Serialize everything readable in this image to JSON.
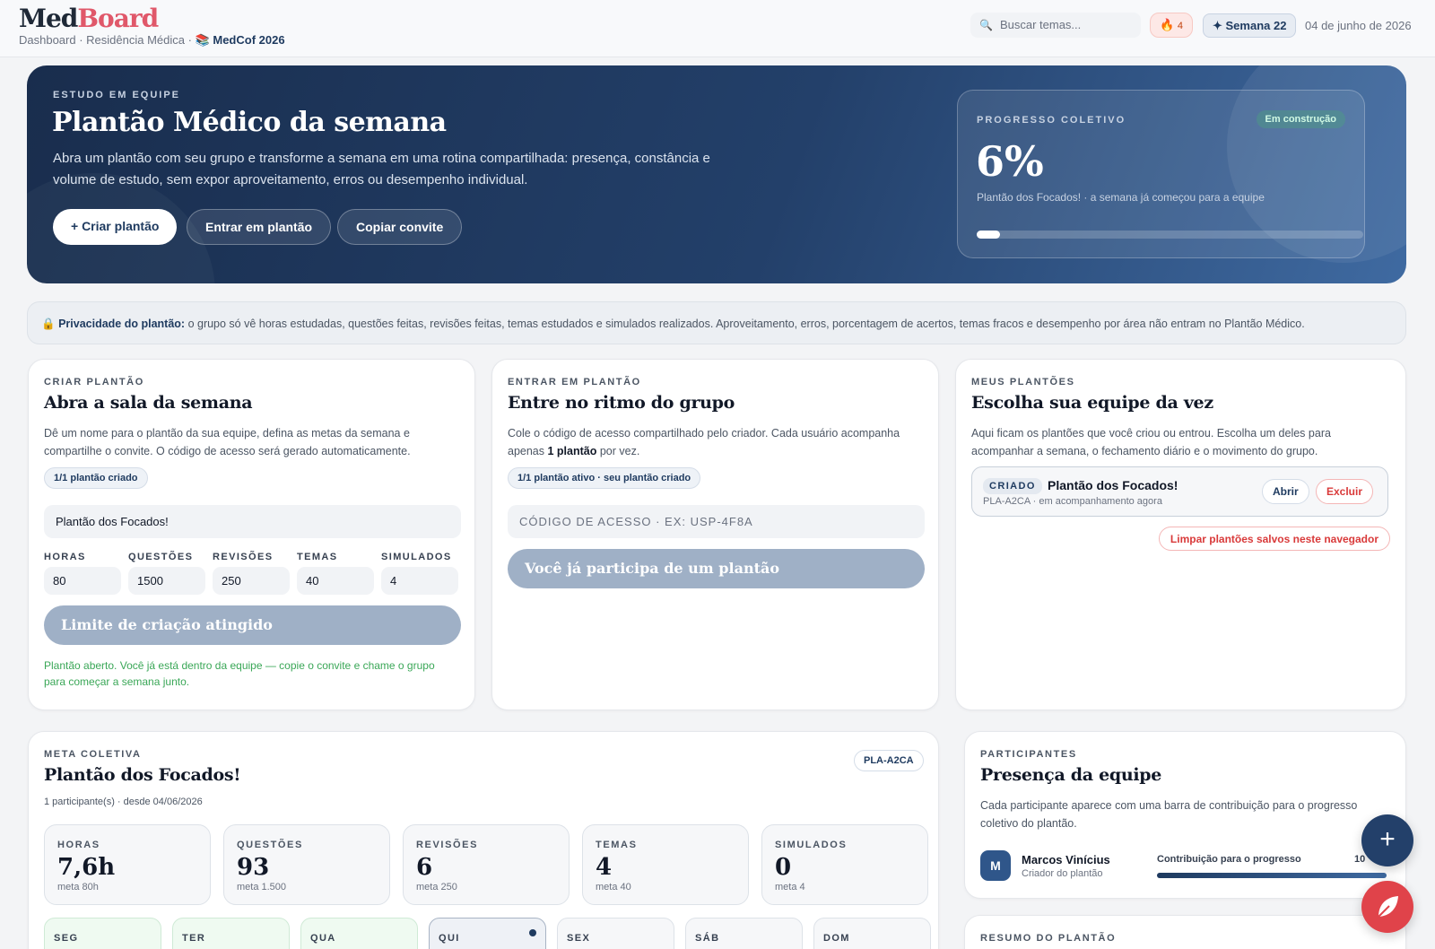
{
  "header": {
    "logo_part1": "Med",
    "logo_part2": "Board",
    "breadcrumb": "Dashboard · Residência Médica ·",
    "breadcrumb_book": "📚",
    "breadcrumb_exam": "MedCof 2026",
    "search_placeholder": "Buscar temas...",
    "streak": "4",
    "week": "✦ Semana 22",
    "date": "04 de junho de 2026"
  },
  "hero": {
    "eyebrow": "ESTUDO EM EQUIPE",
    "title": "Plantão Médico da semana",
    "description": "Abra um plantão com seu grupo e transforme a semana em uma rotina compartilhada: presença, constância e volume de estudo, sem expor aproveitamento, erros ou desempenho individual.",
    "btn_create": "+ Criar plantão",
    "btn_join": "Entrar em plantão",
    "btn_copy": "Copiar convite",
    "progress": {
      "label": "PROGRESSO COLETIVO",
      "badge": "Em construção",
      "percent_text": "6%",
      "percent_value": 6,
      "subtitle": "Plantão dos Focados! · a semana já começou para a equipe"
    }
  },
  "privacy": {
    "lead": "Privacidade do plantão:",
    "text": "o grupo só vê horas estudadas, questões feitas, revisões feitas, temas estudados e simulados realizados. Aproveitamento, erros, porcentagem de acertos, temas fracos e desempenho por área não entram no Plantão Médico."
  },
  "create": {
    "eyebrow": "CRIAR PLANTÃO",
    "title": "Abra a sala da semana",
    "text": "Dê um nome para o plantão da sua equipe, defina as metas da semana e compartilhe o convite. O código de acesso será gerado automaticamente.",
    "pill": "1/1 plantão criado",
    "name_value": "Plantão dos Focados!",
    "goals": [
      {
        "label": "HORAS",
        "value": "80"
      },
      {
        "label": "QUESTÕES",
        "value": "1500"
      },
      {
        "label": "REVISÕES",
        "value": "250"
      },
      {
        "label": "TEMAS",
        "value": "40"
      },
      {
        "label": "SIMULADOS",
        "value": "4"
      }
    ],
    "button": "Limite de criação atingido",
    "success": "Plantão aberto. Você já está dentro da equipe — copie o convite e chame o grupo para começar a semana junto."
  },
  "join": {
    "eyebrow": "ENTRAR EM PLANTÃO",
    "title": "Entre no ritmo do grupo",
    "text_before": "Cole o código de acesso compartilhado pelo criador. Cada usuário acompanha apenas",
    "text_bold": "1 plantão",
    "text_after": "por vez.",
    "pill": "1/1 plantão ativo · seu plantão criado",
    "code_placeholder": "CÓDIGO DE ACESSO · EX: USP-4F8A",
    "button": "Você já participa de um plantão"
  },
  "mine": {
    "eyebrow": "MEUS PLANTÕES",
    "title": "Escolha sua equipe da vez",
    "text": "Aqui ficam os plantões que você criou ou entrou. Escolha um deles para acompanhar a semana, o fechamento diário e o movimento do grupo.",
    "item": {
      "tag": "CRIADO",
      "name": "Plantão dos Focados!",
      "code": "PLA-A2CA · em acompanhamento agora",
      "open": "Abrir",
      "delete": "Excluir"
    },
    "clear": "Limpar plantões salvos neste navegador"
  },
  "goal": {
    "eyebrow": "META COLETIVA",
    "title": "Plantão dos Focados!",
    "code": "PLA-A2CA",
    "meta": "1 participante(s) · desde 04/06/2026",
    "stats": [
      {
        "label": "HORAS",
        "value": "7,6h",
        "meta": "meta 80h"
      },
      {
        "label": "QUESTÕES",
        "value": "93",
        "meta": "meta 1.500"
      },
      {
        "label": "REVISÕES",
        "value": "6",
        "meta": "meta 250"
      },
      {
        "label": "TEMAS",
        "value": "4",
        "meta": "meta 40"
      },
      {
        "label": "SIMULADOS",
        "value": "0",
        "meta": "meta 4"
      }
    ],
    "days": [
      "SEG",
      "TER",
      "QUA",
      "QUI",
      "SEX",
      "SÁB",
      "DOM"
    ]
  },
  "participants": {
    "eyebrow": "PARTICIPANTES",
    "title": "Presença da equipe",
    "text": "Cada participante aparece com uma barra de contribuição para o progresso coletivo do plantão.",
    "person": {
      "initial": "M",
      "name": "Marcos Vinícius",
      "role": "Criador do plantão",
      "contribution_label": "Contribuição para o progresso",
      "contribution_text": "10",
      "contribution_value": 100
    }
  },
  "summary": {
    "eyebrow": "RESUMO DO PLANTÃO"
  },
  "fab": {
    "plus": "+"
  },
  "colors": {
    "brand_navy": "#1e3a5f",
    "accent_red": "#e0586a",
    "success_green": "#3aa757",
    "danger_red": "#d93a3a"
  }
}
